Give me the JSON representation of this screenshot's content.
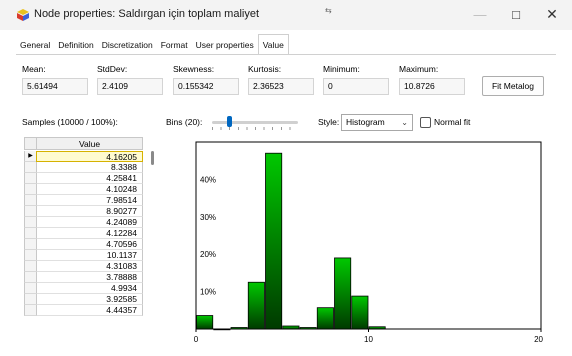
{
  "window": {
    "title": "Node properties: Saldırgan için toplam maliyet",
    "cursor_glyph": "⇆"
  },
  "tabs": [
    "General",
    "Definition",
    "Discretization",
    "Format",
    "User properties",
    "Value"
  ],
  "active_tab": "Value",
  "stats": {
    "mean": {
      "label": "Mean:",
      "value": "5.61494"
    },
    "stddev": {
      "label": "StdDev:",
      "value": "2.4109"
    },
    "skewness": {
      "label": "Skewness:",
      "value": "0.155342"
    },
    "kurtosis": {
      "label": "Kurtosis:",
      "value": "2.36523"
    },
    "minimum": {
      "label": "Minimum:",
      "value": "0"
    },
    "maximum": {
      "label": "Maximum:",
      "value": "10.8726"
    }
  },
  "fit_metalog_label": "Fit Metalog",
  "samples_label": "Samples (10000 / 100%):",
  "bins_label": "Bins (20):",
  "bins_value": 20,
  "style": {
    "label": "Style:",
    "value": "Histogram"
  },
  "normal_fit": {
    "label": "Normal fit",
    "checked": false
  },
  "grid": {
    "header": "Value",
    "values": [
      "4.16205",
      "8.3388",
      "4.25841",
      "4.10248",
      "7.98514",
      "8.90277",
      "4.24089",
      "4.12284",
      "4.70596",
      "10.1137",
      "4.31083",
      "3.78888",
      "4.9934",
      "3.92585",
      "4.44357"
    ],
    "selected_index": 0
  },
  "chart_data": {
    "type": "bar",
    "x_range": [
      0,
      20
    ],
    "y_range": [
      0,
      0.5
    ],
    "xticks": [
      "0",
      "10",
      "20"
    ],
    "yticks": [
      "10%",
      "20%",
      "30%",
      "40%"
    ],
    "bin_width": 1,
    "bins": [
      {
        "x0": 0,
        "value": 0.036
      },
      {
        "x0": 1,
        "value": 0
      },
      {
        "x0": 2,
        "value": 0.004
      },
      {
        "x0": 3,
        "value": 0.125
      },
      {
        "x0": 4,
        "value": 0.47
      },
      {
        "x0": 5,
        "value": 0.008
      },
      {
        "x0": 6,
        "value": 0.004
      },
      {
        "x0": 7,
        "value": 0.057
      },
      {
        "x0": 8,
        "value": 0.19
      },
      {
        "x0": 9,
        "value": 0.088
      },
      {
        "x0": 10,
        "value": 0.006
      }
    ],
    "bar_color_top": "#00c800",
    "bar_color_bottom": "#003a00",
    "grid": false
  }
}
